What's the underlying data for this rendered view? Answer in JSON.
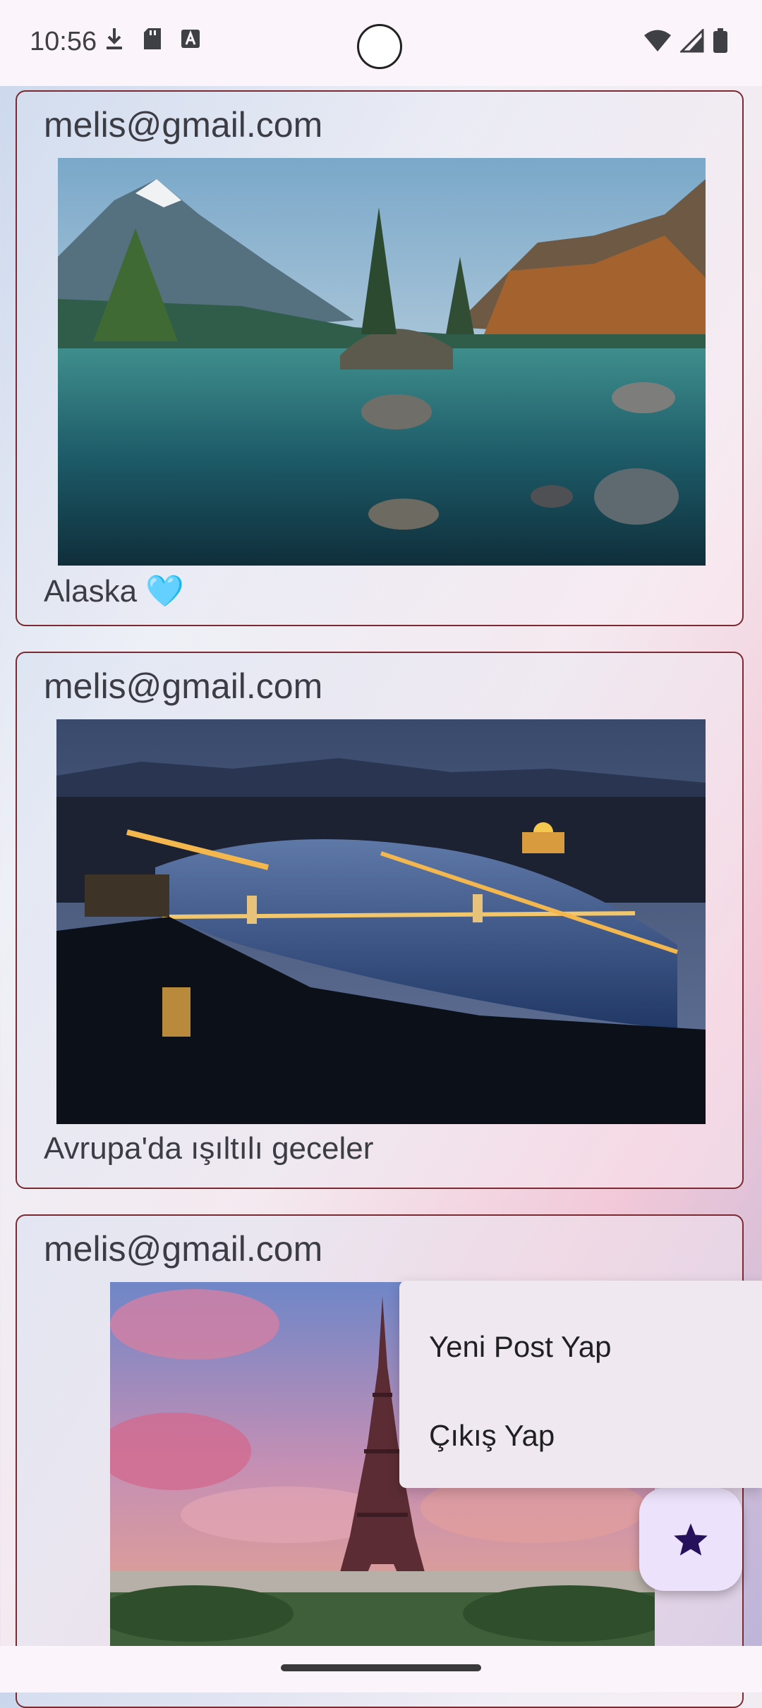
{
  "status_bar": {
    "time": "10:56",
    "left_icons": [
      "download-icon",
      "sd-card-icon",
      "text-a-icon"
    ],
    "right_icons": [
      "wifi-icon",
      "signal-icon",
      "battery-icon"
    ]
  },
  "posts": [
    {
      "email": "melis@gmail.com",
      "caption": "Alaska 🩵",
      "image": "mountain-lake-photo"
    },
    {
      "email": "melis@gmail.com",
      "caption": "Avrupa'da ışıltılı geceler",
      "image": "night-city-river-photo"
    },
    {
      "email": "melis@gmail.com",
      "caption": "",
      "image": "eiffel-tower-photo"
    }
  ],
  "menu": {
    "items": [
      {
        "label": "Yeni Post Yap"
      },
      {
        "label": "Çıkış Yap"
      }
    ]
  },
  "fab": {
    "icon": "star-icon"
  },
  "colors": {
    "card_border": "#7a2a30",
    "fab_bg": "#ece2fb",
    "fab_icon": "#25105c",
    "menu_bg": "#efe8f1"
  }
}
